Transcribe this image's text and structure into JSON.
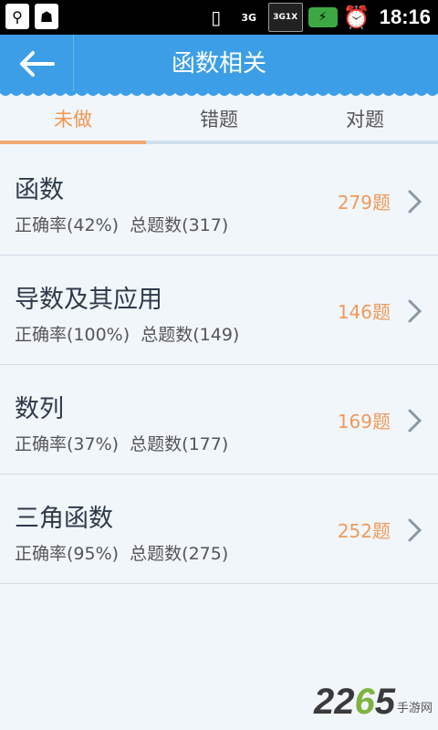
{
  "statusbar": {
    "time": "18:16",
    "net_3g": "3G",
    "net_label": "3G1X"
  },
  "header": {
    "title": "函数相关"
  },
  "tabs": [
    {
      "label": "未做"
    },
    {
      "label": "错题"
    },
    {
      "label": "对题"
    }
  ],
  "items": [
    {
      "title": "函数",
      "accuracy": "正确率(42%)",
      "total": "总题数(317)",
      "count": "279题"
    },
    {
      "title": "导数及其应用",
      "accuracy": "正确率(100%)",
      "total": "总题数(149)",
      "count": "146题"
    },
    {
      "title": "数列",
      "accuracy": "正确率(37%)",
      "total": "总题数(177)",
      "count": "169题"
    },
    {
      "title": "三角函数",
      "accuracy": "正确率(95%)",
      "total": "总题数(275)",
      "count": "252题"
    }
  ],
  "watermark": {
    "num_a": "22",
    "num_b": "6",
    "num_c": "5",
    "text": "手游网"
  },
  "colors": {
    "header": "#3c9ee6",
    "accent": "#f1954d"
  }
}
